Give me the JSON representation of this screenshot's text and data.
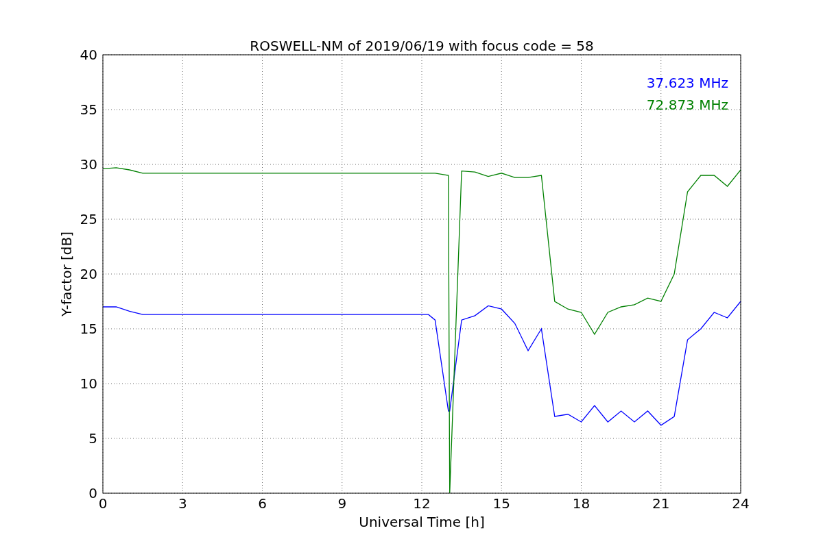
{
  "figure": {
    "chart_data": {
      "type": "line",
      "title": "ROSWELL-NM of 2019/06/19 with focus code = 58",
      "xlabel": "Universal Time [h]",
      "ylabel": "Y-factor [dB]",
      "x": [
        0,
        0.5,
        1,
        1.5,
        3,
        6,
        9,
        12,
        12.25,
        12.5,
        13,
        13.05,
        13.5,
        14,
        14.5,
        15,
        15.5,
        16,
        16.5,
        17,
        17.5,
        18,
        18.5,
        19,
        19.5,
        20,
        20.5,
        21,
        21.5,
        22,
        22.5,
        23,
        23.5,
        24
      ],
      "series": [
        {
          "name": "37.623 MHz",
          "color": "#0000ff",
          "values": [
            17,
            17,
            16.6,
            16.3,
            16.3,
            16.3,
            16.3,
            16.3,
            16.3,
            15.8,
            7.5,
            7.5,
            15.8,
            16.2,
            17.1,
            16.8,
            15.5,
            13,
            15,
            7,
            7.2,
            6.5,
            8,
            6.5,
            7.5,
            6.5,
            7.5,
            6.2,
            7,
            14,
            15,
            16.5,
            16,
            17.5
          ]
        },
        {
          "name": "72.873 MHz",
          "color": "#008000",
          "values": [
            29.6,
            29.7,
            29.5,
            29.2,
            29.2,
            29.2,
            29.2,
            29.2,
            29.2,
            29.2,
            29,
            0,
            29.4,
            29.3,
            28.9,
            29.2,
            28.8,
            28.8,
            29,
            17.5,
            16.8,
            16.5,
            14.5,
            16.5,
            17,
            17.2,
            17.8,
            17.5,
            20,
            27.5,
            29,
            29,
            28,
            29.5
          ]
        }
      ],
      "grid": true,
      "xlim": [
        0,
        24
      ],
      "ylim": [
        0,
        40
      ],
      "xticks": [
        0,
        3,
        6,
        9,
        12,
        15,
        18,
        21,
        24
      ],
      "yticks": [
        0,
        5,
        10,
        15,
        20,
        25,
        30,
        35,
        40
      ]
    }
  }
}
